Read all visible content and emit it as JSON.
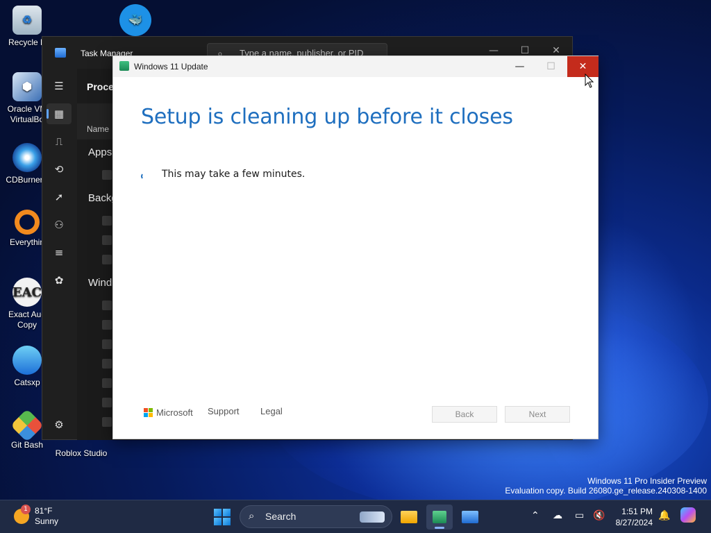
{
  "desktop": {
    "icons": [
      {
        "label": "Recycle B"
      },
      {
        "label": "Oracle VM VirtualBo"
      },
      {
        "label": "CDBurnerX"
      },
      {
        "label": "Everythin"
      },
      {
        "label": "Exact Aud Copy"
      },
      {
        "label": "Catsxp"
      },
      {
        "label": "Git Bash"
      },
      {
        "label": "Roblox Studio"
      }
    ],
    "eac_glyph": "EAC"
  },
  "task_manager": {
    "title": "Task Manager",
    "search_placeholder": "Type a name, publisher, or PID",
    "section_title": "Proce",
    "column_name": "Name",
    "groups": [
      "Apps",
      "Backg",
      "Wind"
    ]
  },
  "update_window": {
    "title": "Windows 11 Update",
    "heading": "Setup is cleaning up before it closes",
    "message": "This may take a few minutes.",
    "brand": "Microsoft",
    "support_link": "Support",
    "legal_link": "Legal",
    "back_button": "Back",
    "next_button": "Next"
  },
  "watermark": {
    "line1": "Windows 11 Pro Insider Preview",
    "line2": "Evaluation copy. Build 26080.ge_release.240308-1400"
  },
  "taskbar": {
    "weather_badge": "1",
    "temperature": "81°F",
    "condition": "Sunny",
    "search_label": "Search",
    "time": "1:51 PM",
    "date": "8/27/2024"
  },
  "colors": {
    "accent_blue": "#1f6fbf",
    "close_red": "#c42b1c"
  }
}
